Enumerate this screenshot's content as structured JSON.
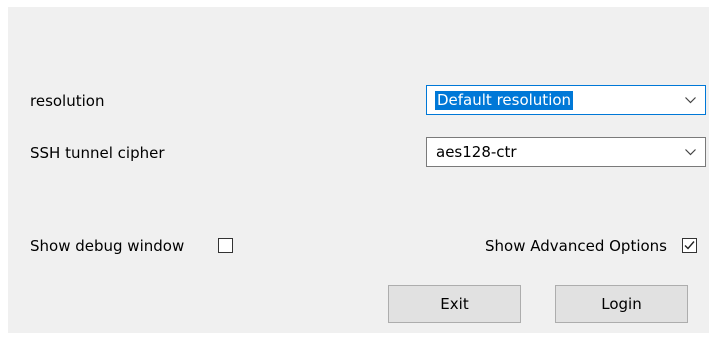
{
  "form": {
    "resolution_label": "resolution",
    "resolution_value": "Default resolution",
    "cipher_label": "SSH tunnel cipher",
    "cipher_value": "aes128-ctr",
    "debug_label": "Show debug window",
    "debug_checked": false,
    "advanced_label": "Show Advanced Options",
    "advanced_checked": true
  },
  "buttons": {
    "exit_label": "Exit",
    "login_label": "Login"
  },
  "colors": {
    "panel_background": "#f0f0f0",
    "selection": "#0078d7",
    "button_face": "#e1e1e1"
  },
  "icons": {
    "dropdown": "chevron-down-icon",
    "checked": "checkmark-icon"
  }
}
